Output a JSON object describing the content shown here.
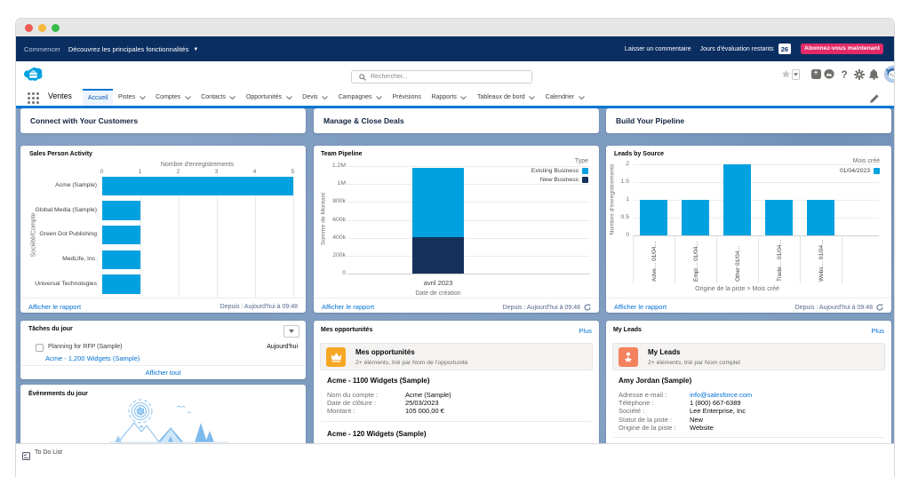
{
  "window": {
    "traffic_lights": [
      "#ee5c54",
      "#f6b73c",
      "#35bb49"
    ]
  },
  "announcement_bar": {
    "bg": "#0b2e61",
    "start_label": "Commencer",
    "discover_label": "Découvrez les principales fonctionnalités",
    "feedback_label": "Laisser un commentaire",
    "trial_label": "Jours d'évaluation restants",
    "trial_days": "26",
    "subscribe_label": "Abonnez-vous maintenant",
    "subscribe_color": "#e32a68"
  },
  "header": {
    "search_placeholder": "Rechercher...",
    "icons": [
      "favorites-star",
      "favorites-dropdown",
      "global-actions-plus",
      "trailhead",
      "help",
      "setup-gear",
      "notifications-bell",
      "avatar"
    ]
  },
  "nav": {
    "app_name": "Ventes",
    "accent": "#0176d3",
    "tabs": [
      {
        "label": "Accueil",
        "active": true,
        "chevron": false
      },
      {
        "label": "Pistes",
        "active": false,
        "chevron": true
      },
      {
        "label": "Comptes",
        "active": false,
        "chevron": true
      },
      {
        "label": "Contacts",
        "active": false,
        "chevron": true
      },
      {
        "label": "Opportunités",
        "active": false,
        "chevron": true
      },
      {
        "label": "Devis",
        "active": false,
        "chevron": true
      },
      {
        "label": "Campagnes",
        "active": false,
        "chevron": true
      },
      {
        "label": "Prévisions",
        "active": false,
        "chevron": false
      },
      {
        "label": "Rapports",
        "active": false,
        "chevron": true
      },
      {
        "label": "Tableaux de bord",
        "active": false,
        "chevron": true
      },
      {
        "label": "Calendrier",
        "active": false,
        "chevron": true
      }
    ]
  },
  "column_headers": [
    "Connect with Your Customers",
    "Manage & Close Deals",
    "Build Your Pipeline"
  ],
  "chart_data": [
    {
      "type": "bar",
      "orientation": "horizontal",
      "title": "Sales Person Activity",
      "xlabel": "Nombre d'enregistrements",
      "ylabel": "Société/Compte",
      "categories": [
        "Acme (Sample)",
        "Global Media (Sample)",
        "Green Dot Publishing",
        "MedLife, Inc.",
        "Universal Technologies"
      ],
      "values": [
        5,
        1,
        1,
        1,
        1
      ],
      "xlim": [
        0,
        5
      ],
      "xticks": [
        "0",
        "1",
        "2",
        "3",
        "4",
        "5"
      ],
      "bar_color": "#00a1e0",
      "grid": true,
      "footer_link": "Afficher le rapport",
      "footer_status": "Depuis : Aujourd'hui à 09:48",
      "refresh_icon": false
    },
    {
      "type": "bar",
      "stacked": true,
      "title": "Team Pipeline",
      "xlabel": "Date de création",
      "ylabel": "Somme de Montant",
      "categories": [
        "avril 2023"
      ],
      "series": [
        {
          "name": "Existing Business",
          "color": "#00a1e0",
          "values": [
            775000
          ]
        },
        {
          "name": "New Business",
          "color": "#16325c",
          "values": [
            410000
          ]
        }
      ],
      "legend_title": "Type",
      "legend_position": "top-right",
      "ylim": [
        0,
        1200000
      ],
      "yticks": [
        {
          "v": 1200000,
          "label": "1.2M"
        },
        {
          "v": 1000000,
          "label": "1M"
        },
        {
          "v": 800000,
          "label": "800k"
        },
        {
          "v": 600000,
          "label": "600k"
        },
        {
          "v": 400000,
          "label": "400k"
        },
        {
          "v": 200000,
          "label": "200k"
        },
        {
          "v": 0,
          "label": "0"
        }
      ],
      "grid": true,
      "footer_link": "Afficher le rapport",
      "footer_status": "Depuis : Aujourd'hui à 09:48",
      "refresh_icon": true
    },
    {
      "type": "bar",
      "orientation": "vertical",
      "title": "Leads by Source",
      "xlabel": "Origine de la piste > Mois créé",
      "ylabel": "Nombre d'enregistrements",
      "categories": [
        "Adve…  01/04…",
        "Empl…  01/04…",
        "Other  01/04…",
        "Trade…  01/04…",
        "Webs…  01/04…"
      ],
      "values": [
        1,
        1,
        2,
        1,
        1
      ],
      "series_name": "01/04/2023",
      "legend_title": "Mois créé",
      "legend_position": "top-right",
      "ylim": [
        0,
        2
      ],
      "yticks": [
        {
          "v": 2,
          "label": "2"
        },
        {
          "v": 1.5,
          "label": "1.5"
        },
        {
          "v": 1,
          "label": "1"
        },
        {
          "v": 0.5,
          "label": "0.5"
        },
        {
          "v": 0,
          "label": "0"
        }
      ],
      "bar_color": "#00a1e0",
      "grid": true,
      "footer_link": "Afficher le rapport",
      "footer_status": "Depuis : Aujourd'hui à 09:48",
      "refresh_icon": true
    }
  ],
  "tasks_card": {
    "title": "Tâches du jour",
    "item": {
      "title": "Planning for RFP (Sample)",
      "due": "Aujourd'hui",
      "link": "Acme - 1,200 Widgets (Sample)"
    },
    "footer_link": "Afficher tout"
  },
  "events_card": {
    "title": "Événements du jour"
  },
  "opportunities_card": {
    "title": "Mes opportunités",
    "more_link": "Plus",
    "icon_color": "#f6a723",
    "banner_title": "Mes opportunités",
    "banner_subtitle": "2+ éléments, trié par Nom de l'opportunité",
    "items": [
      {
        "title": "Acme - 1100 Widgets (Sample)",
        "fields": [
          {
            "label": "Nom du compte :",
            "value": "Acme (Sample)",
            "link": false
          },
          {
            "label": "Date de clôture :",
            "value": "25/03/2023",
            "link": false
          },
          {
            "label": "Montant :",
            "value": "105 000,00 €",
            "link": false
          }
        ]
      },
      {
        "title": "Acme - 120 Widgets (Sample)",
        "fields": []
      }
    ]
  },
  "leads_card": {
    "title": "My Leads",
    "more_link": "Plus",
    "icon_color": "#f4825e",
    "banner_title": "My Leads",
    "banner_subtitle": "2+ éléments, trié par Nom complet",
    "items": [
      {
        "title": "Amy Jordan (Sample)",
        "fields": [
          {
            "label": "Adresse e-mail :",
            "value": "info@salesforce.com",
            "link": true
          },
          {
            "label": "Téléphone :",
            "value": "1 (800) 667-6389",
            "link": false
          },
          {
            "label": "Société :",
            "value": "Lee Enterprise, Inc",
            "link": false
          },
          {
            "label": "Statut de la piste :",
            "value": "New",
            "link": false
          },
          {
            "label": "Origine de la piste :",
            "value": "Website",
            "link": false
          }
        ]
      }
    ]
  },
  "utility_bar": {
    "item_label": "To Do List"
  }
}
